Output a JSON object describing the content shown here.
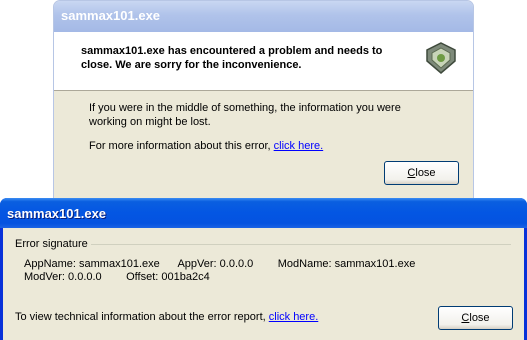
{
  "back_dialog": {
    "title": "sammax101.exe",
    "header_text": "sammax101.exe has encountered a problem and needs to close.  We are sorry for the inconvenience.",
    "body_text": "If you were in the middle of something, the information you were working on might be lost.",
    "more_info_prefix": "For more information about this error, ",
    "more_info_link": "click here.",
    "close_label": "Close"
  },
  "front_dialog": {
    "title": "sammax101.exe",
    "group_label": "Error signature",
    "signature_line1": "AppName: sammax101.exe      AppVer: 0.0.0.0        ModName: sammax101.exe",
    "signature_line2": "ModVer: 0.0.0.0        Offset: 001ba2c4",
    "tech_prefix": "To view technical information about the error report, ",
    "tech_link": "click here.",
    "close_label": "Close"
  },
  "icons": {
    "app": "shield-app-icon"
  },
  "colors": {
    "titlebar_active": "#0456e3",
    "titlebar_inactive": "#a4b9e6",
    "dialog_face": "#ece9d8",
    "link": "#0000ff"
  }
}
